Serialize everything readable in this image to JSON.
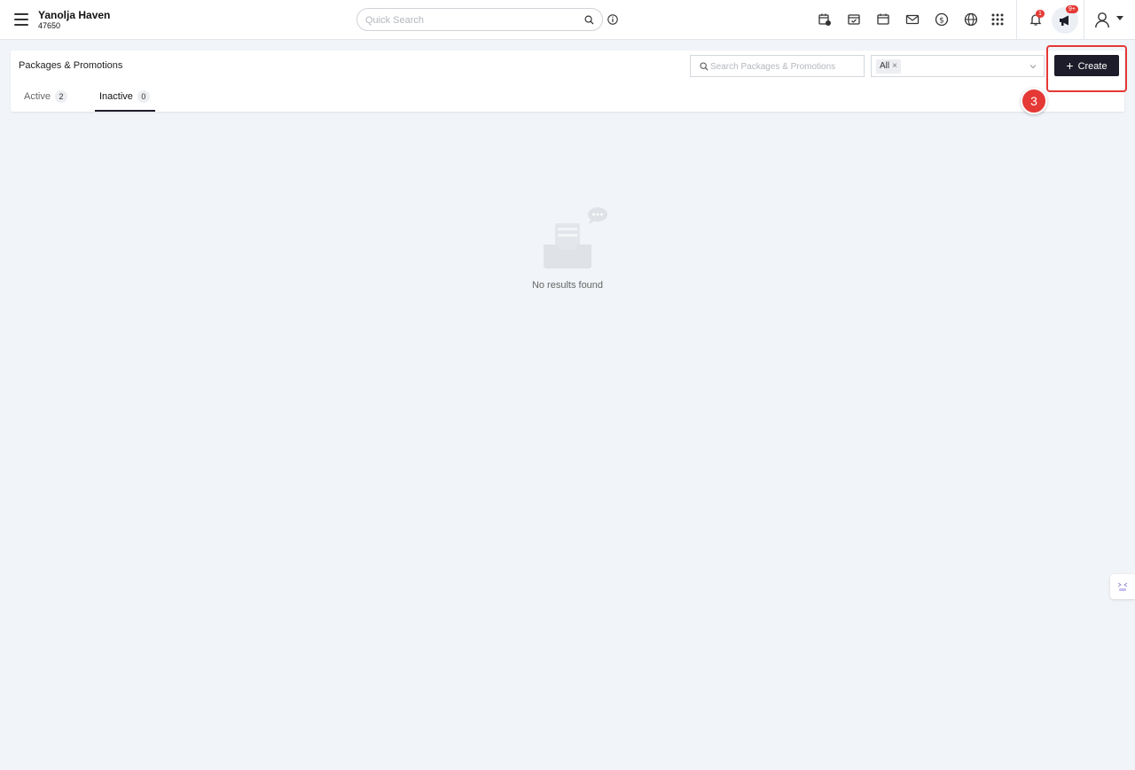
{
  "header": {
    "property_name": "Yanolja Haven",
    "property_code": "47650",
    "quick_search_placeholder": "Quick Search",
    "notification_badge": "1",
    "announcement_badge": "9+"
  },
  "page": {
    "title": "Packages & Promotions",
    "search_placeholder": "Search Packages & Promotions",
    "filter_tag": "All",
    "create_label": "Create",
    "tabs": [
      {
        "label": "Active",
        "count": "2",
        "active": false
      },
      {
        "label": "Inactive",
        "count": "0",
        "active": true
      }
    ],
    "empty_message": "No results found"
  },
  "annotation": {
    "step_number": "3",
    "color": "#e53935"
  },
  "colors": {
    "primary_button": "#1c1c2a",
    "badge": "#e53935",
    "background": "#f1f4f8"
  }
}
